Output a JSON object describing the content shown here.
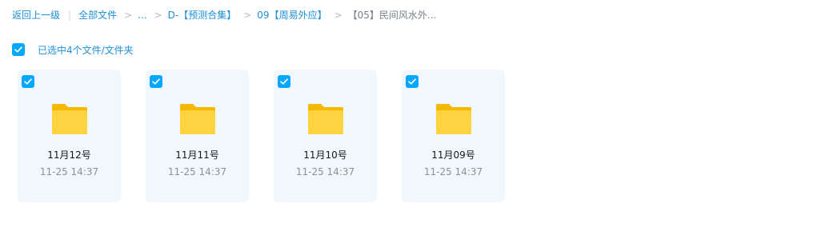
{
  "breadcrumb": {
    "back": "返回上一级",
    "items": [
      "全部文件",
      "...",
      "D-【预测合集】",
      "09【周易外应】"
    ],
    "current": "【05】民间风水外..."
  },
  "selection": {
    "checked": true,
    "label": "已选中4个文件/文件夹"
  },
  "files": [
    {
      "name": "11月12号",
      "modified": "11-25 14:37",
      "checked": true,
      "icon": "folder-icon"
    },
    {
      "name": "11月11号",
      "modified": "11-25 14:37",
      "checked": true,
      "icon": "folder-icon"
    },
    {
      "name": "11月10号",
      "modified": "11-25 14:37",
      "checked": true,
      "icon": "folder-icon"
    },
    {
      "name": "11月09号",
      "modified": "11-25 14:37",
      "checked": true,
      "icon": "folder-icon"
    }
  ],
  "colors": {
    "accent": "#06a7ff",
    "link": "#1e90d8",
    "card_bg": "#f1f8fd",
    "folder_back": "#f5b800",
    "folder_front": "#ffd23f"
  }
}
